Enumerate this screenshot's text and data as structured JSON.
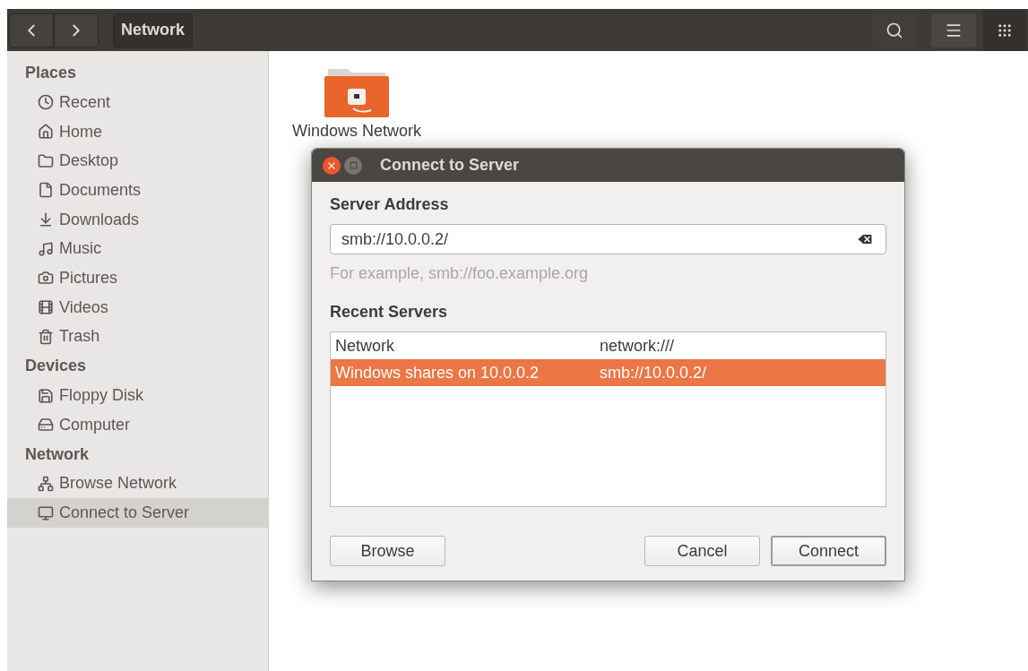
{
  "toolbar": {
    "path": "Network"
  },
  "sidebar": {
    "sections": [
      {
        "title": "Places",
        "items": [
          {
            "label": "Recent",
            "selected": false
          },
          {
            "label": "Home",
            "selected": false
          },
          {
            "label": "Desktop",
            "selected": false
          },
          {
            "label": "Documents",
            "selected": false
          },
          {
            "label": "Downloads",
            "selected": false
          },
          {
            "label": "Music",
            "selected": false
          },
          {
            "label": "Pictures",
            "selected": false
          },
          {
            "label": "Videos",
            "selected": false
          },
          {
            "label": "Trash",
            "selected": false
          }
        ]
      },
      {
        "title": "Devices",
        "items": [
          {
            "label": "Floppy Disk",
            "selected": false
          },
          {
            "label": "Computer",
            "selected": false
          }
        ]
      },
      {
        "title": "Network",
        "items": [
          {
            "label": "Browse Network",
            "selected": false
          },
          {
            "label": "Connect to Server",
            "selected": true
          }
        ]
      }
    ]
  },
  "content": {
    "items": [
      {
        "label": "Windows Network"
      }
    ]
  },
  "dialog": {
    "title": "Connect to Server",
    "address_label": "Server Address",
    "address_value": "smb://10.0.0.2/",
    "hint": "For example, smb://foo.example.org",
    "recent_label": "Recent Servers",
    "servers": [
      {
        "name": "Network",
        "uri": "network:///",
        "selected": false
      },
      {
        "name": "Windows shares on 10.0.0.2",
        "uri": "smb://10.0.0.2/",
        "selected": true
      }
    ],
    "buttons": [
      {
        "label": "Browse",
        "default": false
      },
      {
        "label": "Cancel",
        "default": false
      },
      {
        "label": "Connect",
        "default": true
      }
    ]
  }
}
